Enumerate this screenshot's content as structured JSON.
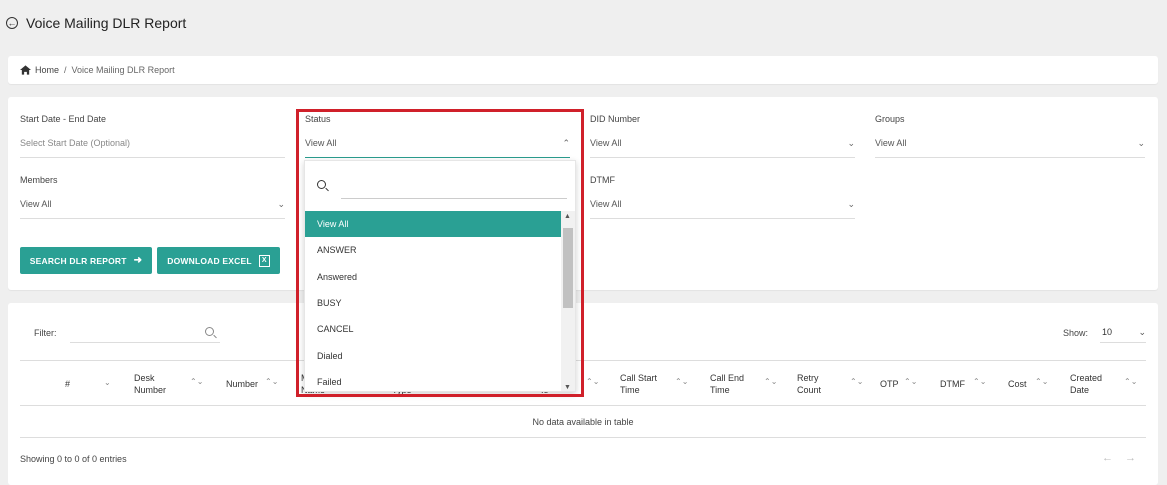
{
  "header": {
    "title": "Voice Mailing DLR Report"
  },
  "breadcrumb": {
    "home": "Home",
    "separator": "/",
    "current": "Voice Mailing DLR Report"
  },
  "filters": {
    "date": {
      "label": "Start Date - End Date",
      "placeholder": "Select Start Date (Optional)"
    },
    "status": {
      "label": "Status",
      "value": "View All"
    },
    "did": {
      "label": "DID Number",
      "value": "View All"
    },
    "groups": {
      "label": "Groups",
      "value": "View All"
    },
    "members": {
      "label": "Members",
      "value": "View All"
    },
    "dtmf": {
      "label": "DTMF",
      "value": "View All"
    }
  },
  "buttons": {
    "search": "SEARCH DLR REPORT",
    "download": "DOWNLOAD EXCEL"
  },
  "table": {
    "filter_label": "Filter:",
    "show_label": "Show:",
    "show_value": "10",
    "columns": {
      "hash": "#",
      "desk": [
        "Desk",
        "Number"
      ],
      "number": "Number",
      "name": [
        "M",
        "Name"
      ],
      "type": "Type",
      "id": "Io",
      "call_start": [
        "Call Start",
        "Time"
      ],
      "call_end": [
        "Call End",
        "Time"
      ],
      "retry": [
        "Retry",
        "Count"
      ],
      "otp": "OTP",
      "dtmf": "DTMF",
      "cost": "Cost",
      "created": [
        "Created",
        "Date"
      ]
    },
    "empty_message": "No data available in table",
    "info": "Showing 0 to 0 of 0 entries",
    "pager": {
      "prev": "←",
      "next": "→"
    }
  },
  "status_dropdown": {
    "options": [
      "View All",
      "ANSWER",
      "Answered",
      "BUSY",
      "CANCEL",
      "Dialed",
      "Failed"
    ],
    "selected": "View All"
  },
  "colors": {
    "accent": "#2aa094",
    "highlight": "#d0202a"
  }
}
